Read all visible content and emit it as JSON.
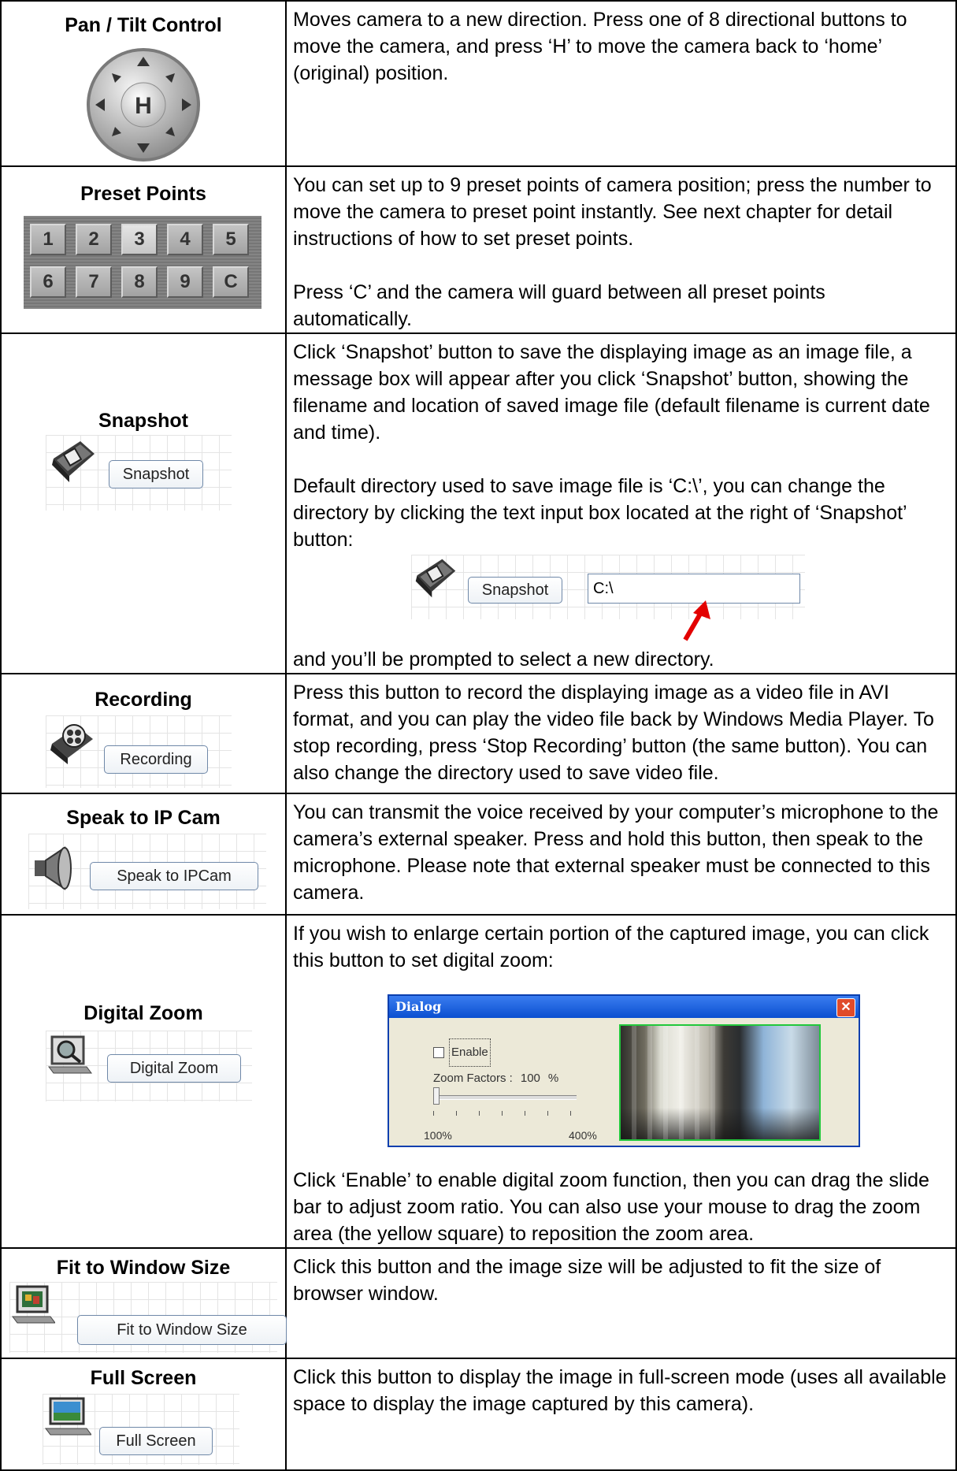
{
  "rows": [
    {
      "title": "Pan / Tilt Control",
      "desc": [
        "Moves camera to a new direction. Press one of 8 directional buttons to move the camera, and press ‘H’ to move the camera back to ‘home’ (original) position."
      ],
      "control": {
        "home_label": "H"
      }
    },
    {
      "title": "Preset Points",
      "desc": [
        "You can set up to 9 preset points of camera position; press the number to move the camera to preset point instantly. See next chapter for detail instructions of how to set preset points.",
        "Press ‘C’ and the camera will guard between all preset points automatically."
      ],
      "keys": [
        "1",
        "2",
        "3",
        "4",
        "5",
        "6",
        "7",
        "8",
        "9",
        "C"
      ]
    },
    {
      "title": "Snapshot",
      "button": "Snapshot",
      "desc": [
        "Click ‘Snapshot’ button to save the displaying image as an image file, a message box will appear after you click ‘Snapshot’ button, showing the filename and location of saved image file (default filename is current date and time).",
        "Default directory used to save image file is ‘C:\\’, you can change the directory by clicking the text input box located at the right of ‘Snapshot’ button:",
        "and you’ll be prompted to select a new directory."
      ],
      "example": {
        "button": "Snapshot",
        "path": "C:\\"
      }
    },
    {
      "title": "Recording",
      "button": "Recording",
      "desc": [
        "Press this button to record the displaying image as a video file in AVI format, and you can play the video file back by Windows Media Player. To stop recording, press ‘Stop Recording’ button (the same button). You can also change the directory used to save video file."
      ]
    },
    {
      "title": "Speak to IP Cam",
      "button": "Speak to IPCam",
      "desc": [
        "You can transmit the voice received by your computer’s microphone to the camera’s external speaker. Press and hold this button, then speak to the microphone. Please note that external speaker must be connected to this camera."
      ]
    },
    {
      "title": "Digital Zoom",
      "button": "Digital Zoom",
      "desc": [
        "If you wish to enlarge certain portion of the captured image, you can click this button to set digital zoom:",
        "Click ‘Enable’ to enable digital zoom function, then you can drag the slide bar to adjust zoom ratio. You can also use your mouse to drag the zoom area (the yellow square) to reposition the zoom area."
      ],
      "dialog": {
        "title": "Dialog",
        "enable_label": "Enable",
        "enable_checked": false,
        "zoom_label": "Zoom Factors :",
        "zoom_value": "100",
        "zoom_unit": "%",
        "slider_min": "100%",
        "slider_max": "400%",
        "slider_fraction": 0
      }
    },
    {
      "title": "Fit to Window Size",
      "button": "Fit to Window Size",
      "desc": [
        "Click this button and the image size will be adjusted to fit the size of browser window."
      ]
    },
    {
      "title": "Full Screen",
      "button": "Full Screen",
      "desc": [
        "Click this button to display the image in full-screen mode (uses all available space to display the image captured by this camera)."
      ]
    }
  ]
}
